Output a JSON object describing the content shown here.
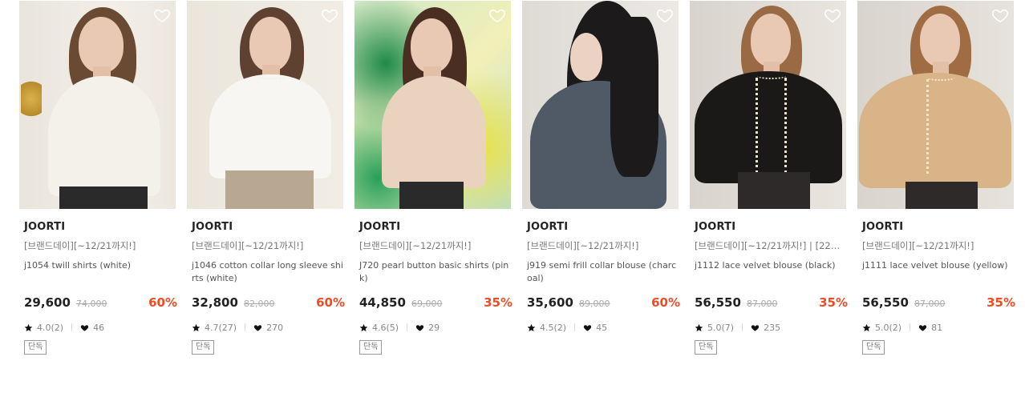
{
  "products": [
    {
      "brand": "JOORTI",
      "promo": "[브랜드데이][~12/21까지!]",
      "name": "j1054 twill shirts (white)",
      "price": "29,600",
      "original_price": "74,000",
      "discount": "60%",
      "rating": "4.0(2)",
      "likes": "46",
      "tag": "단독"
    },
    {
      "brand": "JOORTI",
      "promo": "[브랜드데이][~12/21까지!]",
      "name": "j1046 cotton collar long sleeve shirts (white)",
      "price": "32,800",
      "original_price": "82,000",
      "discount": "60%",
      "rating": "4.7(27)",
      "likes": "270",
      "tag": "단독"
    },
    {
      "brand": "JOORTI",
      "promo": "[브랜드데이][~12/21까지!]",
      "name": "J720 pearl button basic shirts (pink)",
      "price": "44,850",
      "original_price": "69,000",
      "discount": "35%",
      "rating": "4.6(5)",
      "likes": "29",
      "tag": "단독"
    },
    {
      "brand": "JOORTI",
      "promo": "[브랜드데이][~12/21까지!]",
      "name": "j919 semi frill collar blouse (charcoal)",
      "price": "35,600",
      "original_price": "89,000",
      "discount": "60%",
      "rating": "4.5(2)",
      "likes": "45",
      "tag": ""
    },
    {
      "brand": "JOORTI",
      "promo": "[브랜드데이][~12/21까지!] | [22WIN...",
      "name": "j1112 lace velvet blouse (black)",
      "price": "56,550",
      "original_price": "87,000",
      "discount": "35%",
      "rating": "5.0(7)",
      "likes": "235",
      "tag": "단독"
    },
    {
      "brand": "JOORTI",
      "promo": "[브랜드데이][~12/21까지!]",
      "name": "j1111 lace velvet blouse (yellow)",
      "price": "56,550",
      "original_price": "87,000",
      "discount": "35%",
      "rating": "5.0(2)",
      "likes": "81",
      "tag": "단독"
    }
  ],
  "colors": {
    "discount": "#ef4b24",
    "brand": "#222222",
    "muted": "#888888"
  },
  "icons": {
    "wishlist": "heart-outline-icon",
    "rating": "star-icon",
    "likes": "heart-filled-icon"
  }
}
